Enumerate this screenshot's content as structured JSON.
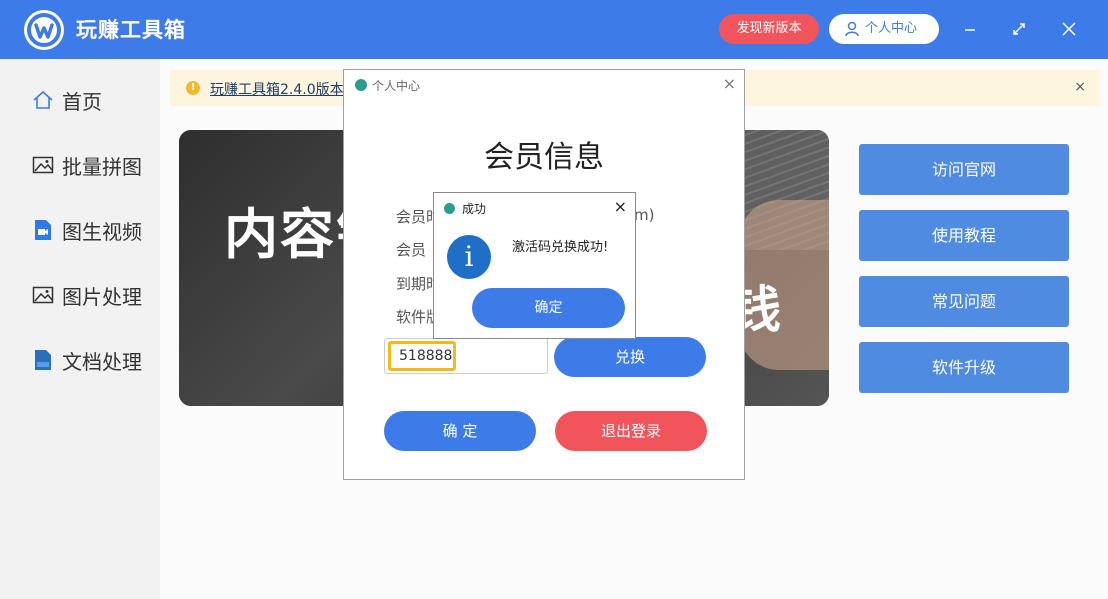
{
  "app": {
    "title": "玩赚工具箱"
  },
  "header": {
    "new_version": "发现新版本",
    "user_center": "个人中心"
  },
  "sidebar": {
    "items": [
      {
        "label": "首页",
        "icon": "home-icon"
      },
      {
        "label": "批量拼图",
        "icon": "image-icon"
      },
      {
        "label": "图生视频",
        "icon": "video-file-icon"
      },
      {
        "label": "图片处理",
        "icon": "image-icon"
      },
      {
        "label": "文档处理",
        "icon": "doc-file-icon"
      }
    ]
  },
  "notice": {
    "text": "玩赚工具箱2.4.0版本_",
    "close": "×"
  },
  "banner": {
    "text1": "内容销",
    "text2": "钱"
  },
  "side_buttons": [
    "访问官网",
    "使用教程",
    "常见问题",
    "软件升级"
  ],
  "account_dialog": {
    "title": "个人中心",
    "heading": "会员信息",
    "rows": [
      {
        "label": "会员时",
        "value": "m)"
      },
      {
        "label": "会员",
        "value": ""
      },
      {
        "label": "到期时",
        "value": ""
      },
      {
        "label": "软件版",
        "value": ""
      }
    ],
    "code_value": "518888",
    "redeem": "兑换",
    "ok": "确 定",
    "logout": "退出登录"
  },
  "success_dialog": {
    "title": "成功",
    "message": "激活码兑换成功!",
    "ok": "确定"
  },
  "colors": {
    "primary": "#3d7be8",
    "danger": "#f2545b",
    "side_button": "#4f8be0",
    "highlight": "#f6b91a"
  }
}
